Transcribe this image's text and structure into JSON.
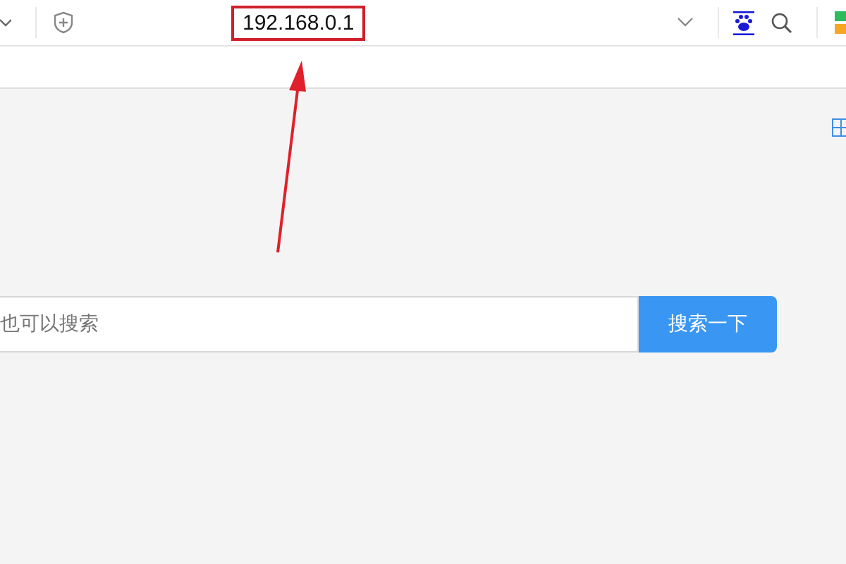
{
  "address_bar": {
    "url": "192.168.0.1"
  },
  "search": {
    "placeholder": "也可以搜索",
    "button": "搜索一下"
  }
}
